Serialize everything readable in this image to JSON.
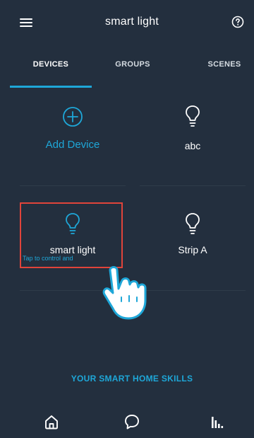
{
  "header": {
    "title": "smart light",
    "menu_icon": "hamburger-menu-icon",
    "help_icon": "help-circle-icon"
  },
  "tabs": [
    {
      "label": "DEVICES",
      "active": true
    },
    {
      "label": "GROUPS",
      "active": false
    },
    {
      "label": "SCENES",
      "active": false
    }
  ],
  "devices": {
    "add_device_label": "Add Device",
    "items": [
      {
        "label": "abc",
        "icon": "bulb-icon"
      },
      {
        "label": "smart light",
        "icon": "bulb-icon",
        "hint": "Tap to control and"
      },
      {
        "label": "Strip A",
        "icon": "bulb-icon"
      }
    ]
  },
  "skills_link": "YOUR SMART HOME SKILLS",
  "bottom_nav": [
    {
      "icon": "home-icon"
    },
    {
      "icon": "chat-icon"
    },
    {
      "icon": "activity-icon"
    }
  ],
  "colors": {
    "background": "#232f3e",
    "accent": "#1ea7d8",
    "highlight": "#e0443a"
  }
}
